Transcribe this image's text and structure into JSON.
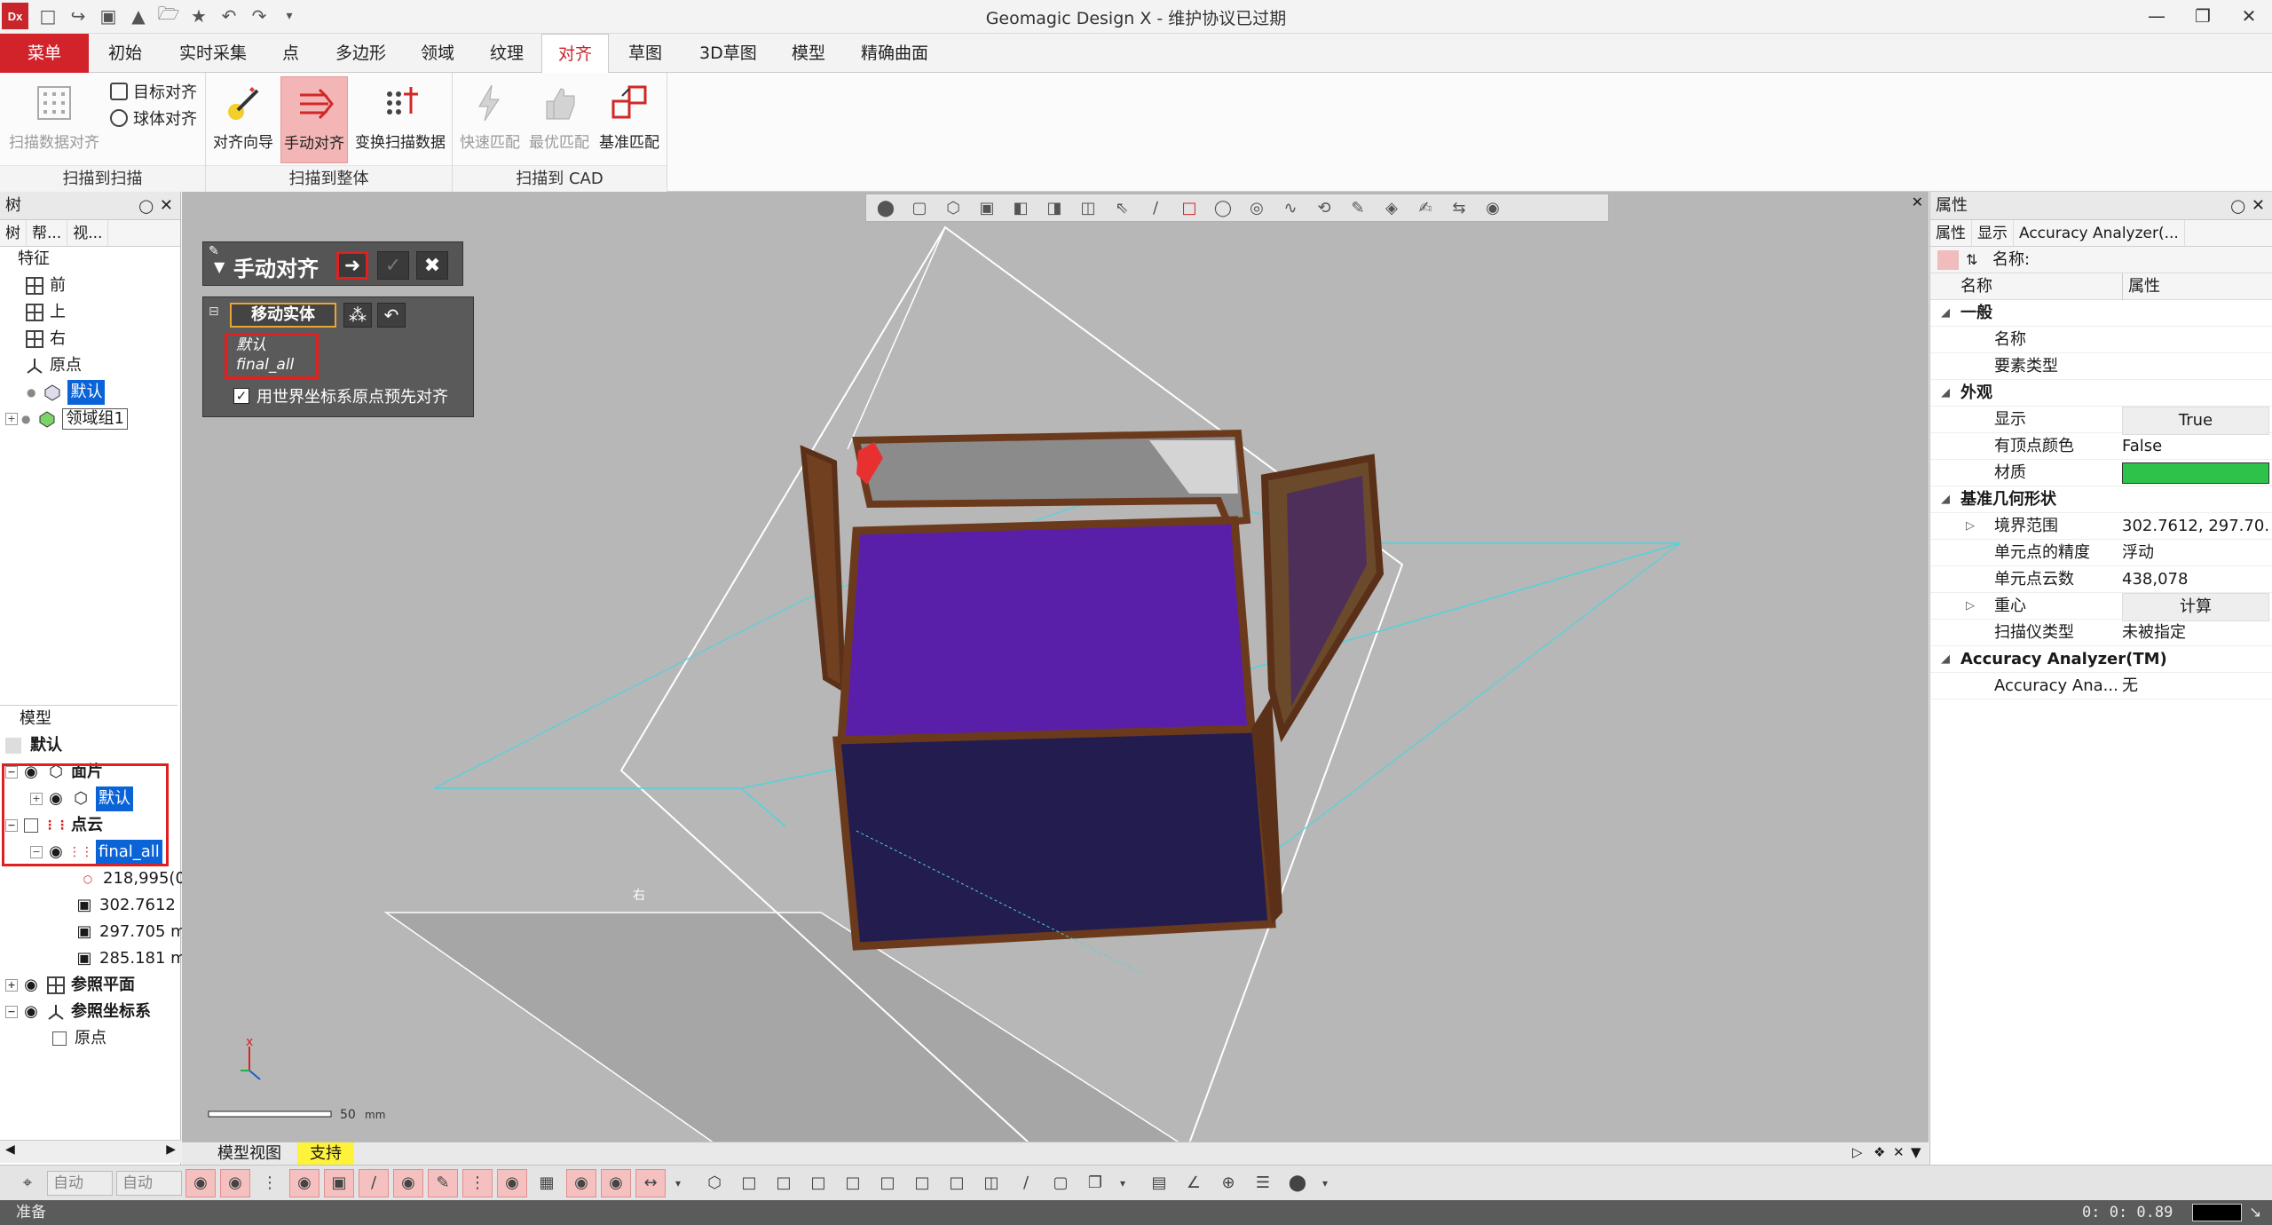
{
  "window": {
    "title": "Geomagic Design X - 维护协议已过期",
    "logo": "Dx"
  },
  "quick_access": [
    "new-icon",
    "open-icon",
    "save-icon",
    "import-icon",
    "folder-icon",
    "folder-star-icon",
    "undo-icon",
    "redo-icon",
    "dropdown-icon"
  ],
  "ribbon_tabs": [
    "菜单",
    "初始",
    "实时采集",
    "点",
    "多边形",
    "领域",
    "纹理",
    "对齐",
    "草图",
    "3D草图",
    "模型",
    "精确曲面"
  ],
  "active_tab": "对齐",
  "ribbon_groups": [
    {
      "label": "扫描到扫描",
      "buttons": [
        "扫描数据对齐"
      ],
      "small_buttons": [
        "目标对齐",
        "球体对齐"
      ]
    },
    {
      "label": "扫描到整体",
      "buttons": [
        "对齐向导",
        "手动对齐",
        "变换扫描数据"
      ]
    },
    {
      "label": "扫描到 CAD",
      "buttons": [
        "快速匹配",
        "最优匹配",
        "基准匹配"
      ]
    }
  ],
  "left_panel": {
    "title": "树",
    "tabs": [
      "树",
      "帮...",
      "视..."
    ],
    "feature_header": "特征",
    "features": [
      "前",
      "上",
      "右",
      "原点",
      "默认",
      "领域组1"
    ],
    "model_header": "模型",
    "model_root": "默认",
    "model_items": {
      "mesh": "面片",
      "mesh_child": "默认",
      "pointcloud": "点云",
      "pointcloud_child": "final_all",
      "point_count": "218,995(0",
      "dim1": "302.7612",
      "dim2": "297.705 m",
      "dim3": "285.181 m",
      "ref_planes": "参照平面",
      "ref_coords": "参照坐标系",
      "origin": "原点"
    }
  },
  "manual_align": {
    "title": "手动对齐",
    "move_entity": "移动实体",
    "entities": [
      "默认",
      "final_all"
    ],
    "world_origin_checkbox": "用世界坐标系原点预先对齐",
    "world_origin_checked": true
  },
  "viewport": {
    "scale_label": "50",
    "scale_unit": "mm",
    "plane_label": "右",
    "colors": {
      "background": "#b7b7b7",
      "box_front": "#231d4f",
      "box_top": "#5a1fa8",
      "box_edge": "#6b3a1c",
      "lid": "#8c8c8c",
      "wire": "#ffffff",
      "cyan": "#3fd6e0"
    }
  },
  "right_panel": {
    "title": "属性",
    "tabs": [
      "属性",
      "显示",
      "Accuracy Analyzer(..."
    ],
    "name_label": "名称:",
    "col_name": "名称",
    "col_value": "属性",
    "sections": [
      {
        "title": "一般",
        "rows": [
          [
            "名称",
            ""
          ],
          [
            "要素类型",
            ""
          ]
        ]
      },
      {
        "title": "外观",
        "rows": [
          [
            "显示",
            "True"
          ],
          [
            "有顶点颜色",
            "False"
          ],
          [
            "材质",
            ""
          ]
        ]
      },
      {
        "title": "基准几何形状",
        "rows": [
          [
            "境界范围",
            "302.7612, 297.70..."
          ],
          [
            "单元点的精度",
            "浮动"
          ],
          [
            "单元点云数",
            "438,078"
          ],
          [
            "重心",
            "计算"
          ],
          [
            "扫描仪类型",
            "未被指定"
          ]
        ]
      },
      {
        "title": "Accuracy Analyzer(TM)",
        "rows": [
          [
            "Accuracy Ana...",
            "无"
          ]
        ]
      }
    ],
    "material_color": "#2ec24a"
  },
  "bottom_tabs": [
    "模型视图",
    "支持"
  ],
  "bottom_autos": [
    "自动",
    "自动"
  ],
  "status": {
    "left": "准备",
    "time": "0: 0: 0.89"
  }
}
